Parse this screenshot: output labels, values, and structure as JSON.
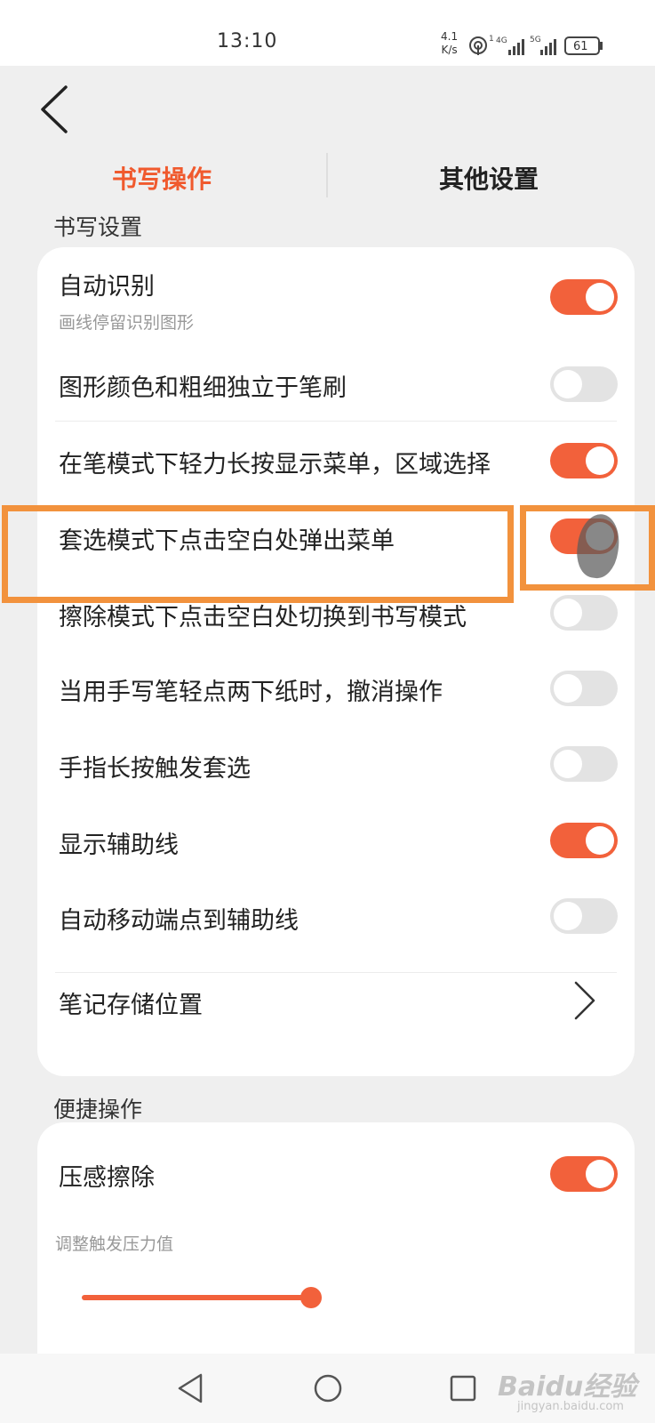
{
  "status_bar": {
    "time": "13:10",
    "net_speed_value": "4.1",
    "net_speed_unit": "K/s",
    "sim1_label": "1",
    "sim1_network": "4G",
    "sim2_network": "5G",
    "battery": "61"
  },
  "tabs": [
    {
      "label": "书写操作",
      "active": true
    },
    {
      "label": "其他设置",
      "active": false
    }
  ],
  "writing_section": {
    "title": "书写设置",
    "rows": [
      {
        "label": "自动识别",
        "sublabel": "画线停留识别图形",
        "toggle": true
      },
      {
        "label": "图形颜色和粗细独立于笔刷",
        "toggle": false
      },
      {
        "label": "在笔模式下轻力长按显示菜单，区域选择",
        "toggle": true
      },
      {
        "label": "套选模式下点击空白处弹出菜单",
        "toggle": true
      },
      {
        "label": "擦除模式下点击空白处切换到书写模式",
        "toggle": false
      },
      {
        "label": "当用手写笔轻点两下纸时，撤消操作",
        "toggle": false
      },
      {
        "label": "手指长按触发套选",
        "toggle": false
      },
      {
        "label": "显示辅助线",
        "toggle": true
      },
      {
        "label": "自动移动端点到辅助线",
        "toggle": false
      },
      {
        "label": "笔记存储位置",
        "type": "link"
      }
    ]
  },
  "shortcut_section": {
    "title": "便捷操作",
    "rows": [
      {
        "label": "压感擦除",
        "toggle": true
      }
    ],
    "pressure_label": "调整触发压力值"
  },
  "watermark": {
    "brand": "Baidu经验",
    "site": "jingyan.baidu.com"
  },
  "colors": {
    "accent": "#f05a2e",
    "toggle_on": "#f2613b",
    "toggle_off": "#e3e3e3",
    "highlight": "#f2923d"
  },
  "icons": {
    "back": "chevron-left-icon",
    "link": "chevron-right-icon",
    "nav_back": "triangle-back-icon",
    "nav_home": "circle-home-icon",
    "nav_recents": "square-recents-icon"
  }
}
